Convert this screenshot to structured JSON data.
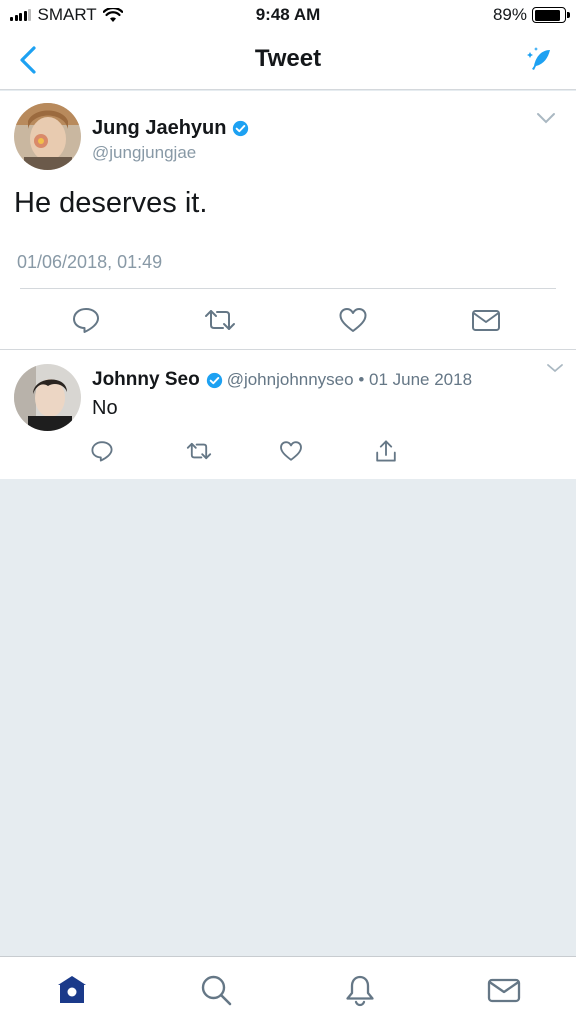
{
  "status_bar": {
    "carrier": "SMART",
    "time": "9:48 AM",
    "battery_percent": "89%",
    "battery_level": 0.89
  },
  "nav": {
    "title": "Tweet"
  },
  "main_tweet": {
    "author_name": "Jung Jaehyun",
    "author_handle": "@jungjungjae",
    "verified": true,
    "text": "He deserves it.",
    "timestamp": "01/06/2018, 01:49",
    "actions": [
      "reply-icon",
      "retweet-icon",
      "like-icon",
      "message-icon"
    ]
  },
  "reply": {
    "author_name": "Johnny Seo",
    "author_handle": "@johnjohnnyseo",
    "separator": " • ",
    "date": "01 June 2018",
    "verified": true,
    "text": "No",
    "actions": [
      "reply-icon",
      "retweet-icon",
      "like-icon",
      "share-icon"
    ]
  },
  "tab_bar": {
    "tabs": [
      "home-icon",
      "search-icon",
      "notifications-icon",
      "messages-icon"
    ],
    "active": "home-icon"
  },
  "colors": {
    "accent": "#1da1f2",
    "active_tab": "#1b3a8a",
    "icon_gray": "#657786",
    "background": "#e6ecf0"
  }
}
